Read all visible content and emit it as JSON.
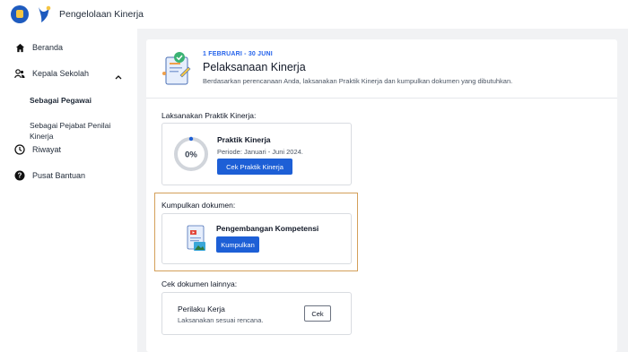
{
  "header": {
    "app_title": "Pengelolaan Kinerja"
  },
  "sidebar": {
    "items": [
      {
        "label": "Beranda",
        "icon": "home-icon"
      },
      {
        "label": "Kepala Sekolah",
        "icon": "users-icon"
      },
      {
        "label": "Riwayat",
        "icon": "clock-icon"
      },
      {
        "label": "Pusat Bantuan",
        "icon": "help-icon"
      }
    ],
    "sub_items": [
      {
        "label": "Sebagai Pegawai",
        "active": true
      },
      {
        "label_line1": "Sebagai Pejabat Penilai",
        "label_line2": "Kinerja"
      }
    ]
  },
  "hero": {
    "date": "1 FEBRUARI - 30 JUNI",
    "title": "Pelaksanaan Kinerja",
    "description": "Berdasarkan perencanaan Anda, laksanakan Praktik Kinerja dan kumpulkan dokumen yang dibutuhkan."
  },
  "praktik": {
    "section_label": "Laksanakan Praktik Kinerja:",
    "title": "Praktik Kinerja",
    "period": "Periode: Januari - Juni 2024.",
    "progress_text": "0%",
    "progress": 0,
    "button": "Cek Praktik Kinerja"
  },
  "dokumen": {
    "section_label": "Kumpulkan dokumen:",
    "title": "Pengembangan Kompetensi",
    "button": "Kumpulkan"
  },
  "lainnya": {
    "section_label": "Cek dokumen lainnya:",
    "title": "Perilaku Kerja",
    "subtitle": "Laksanakan sesuai rencana.",
    "button": "Cek"
  },
  "colors": {
    "primary": "#1d5fd6",
    "highlight": "#d4a05a",
    "background": "#f1f2f4"
  }
}
